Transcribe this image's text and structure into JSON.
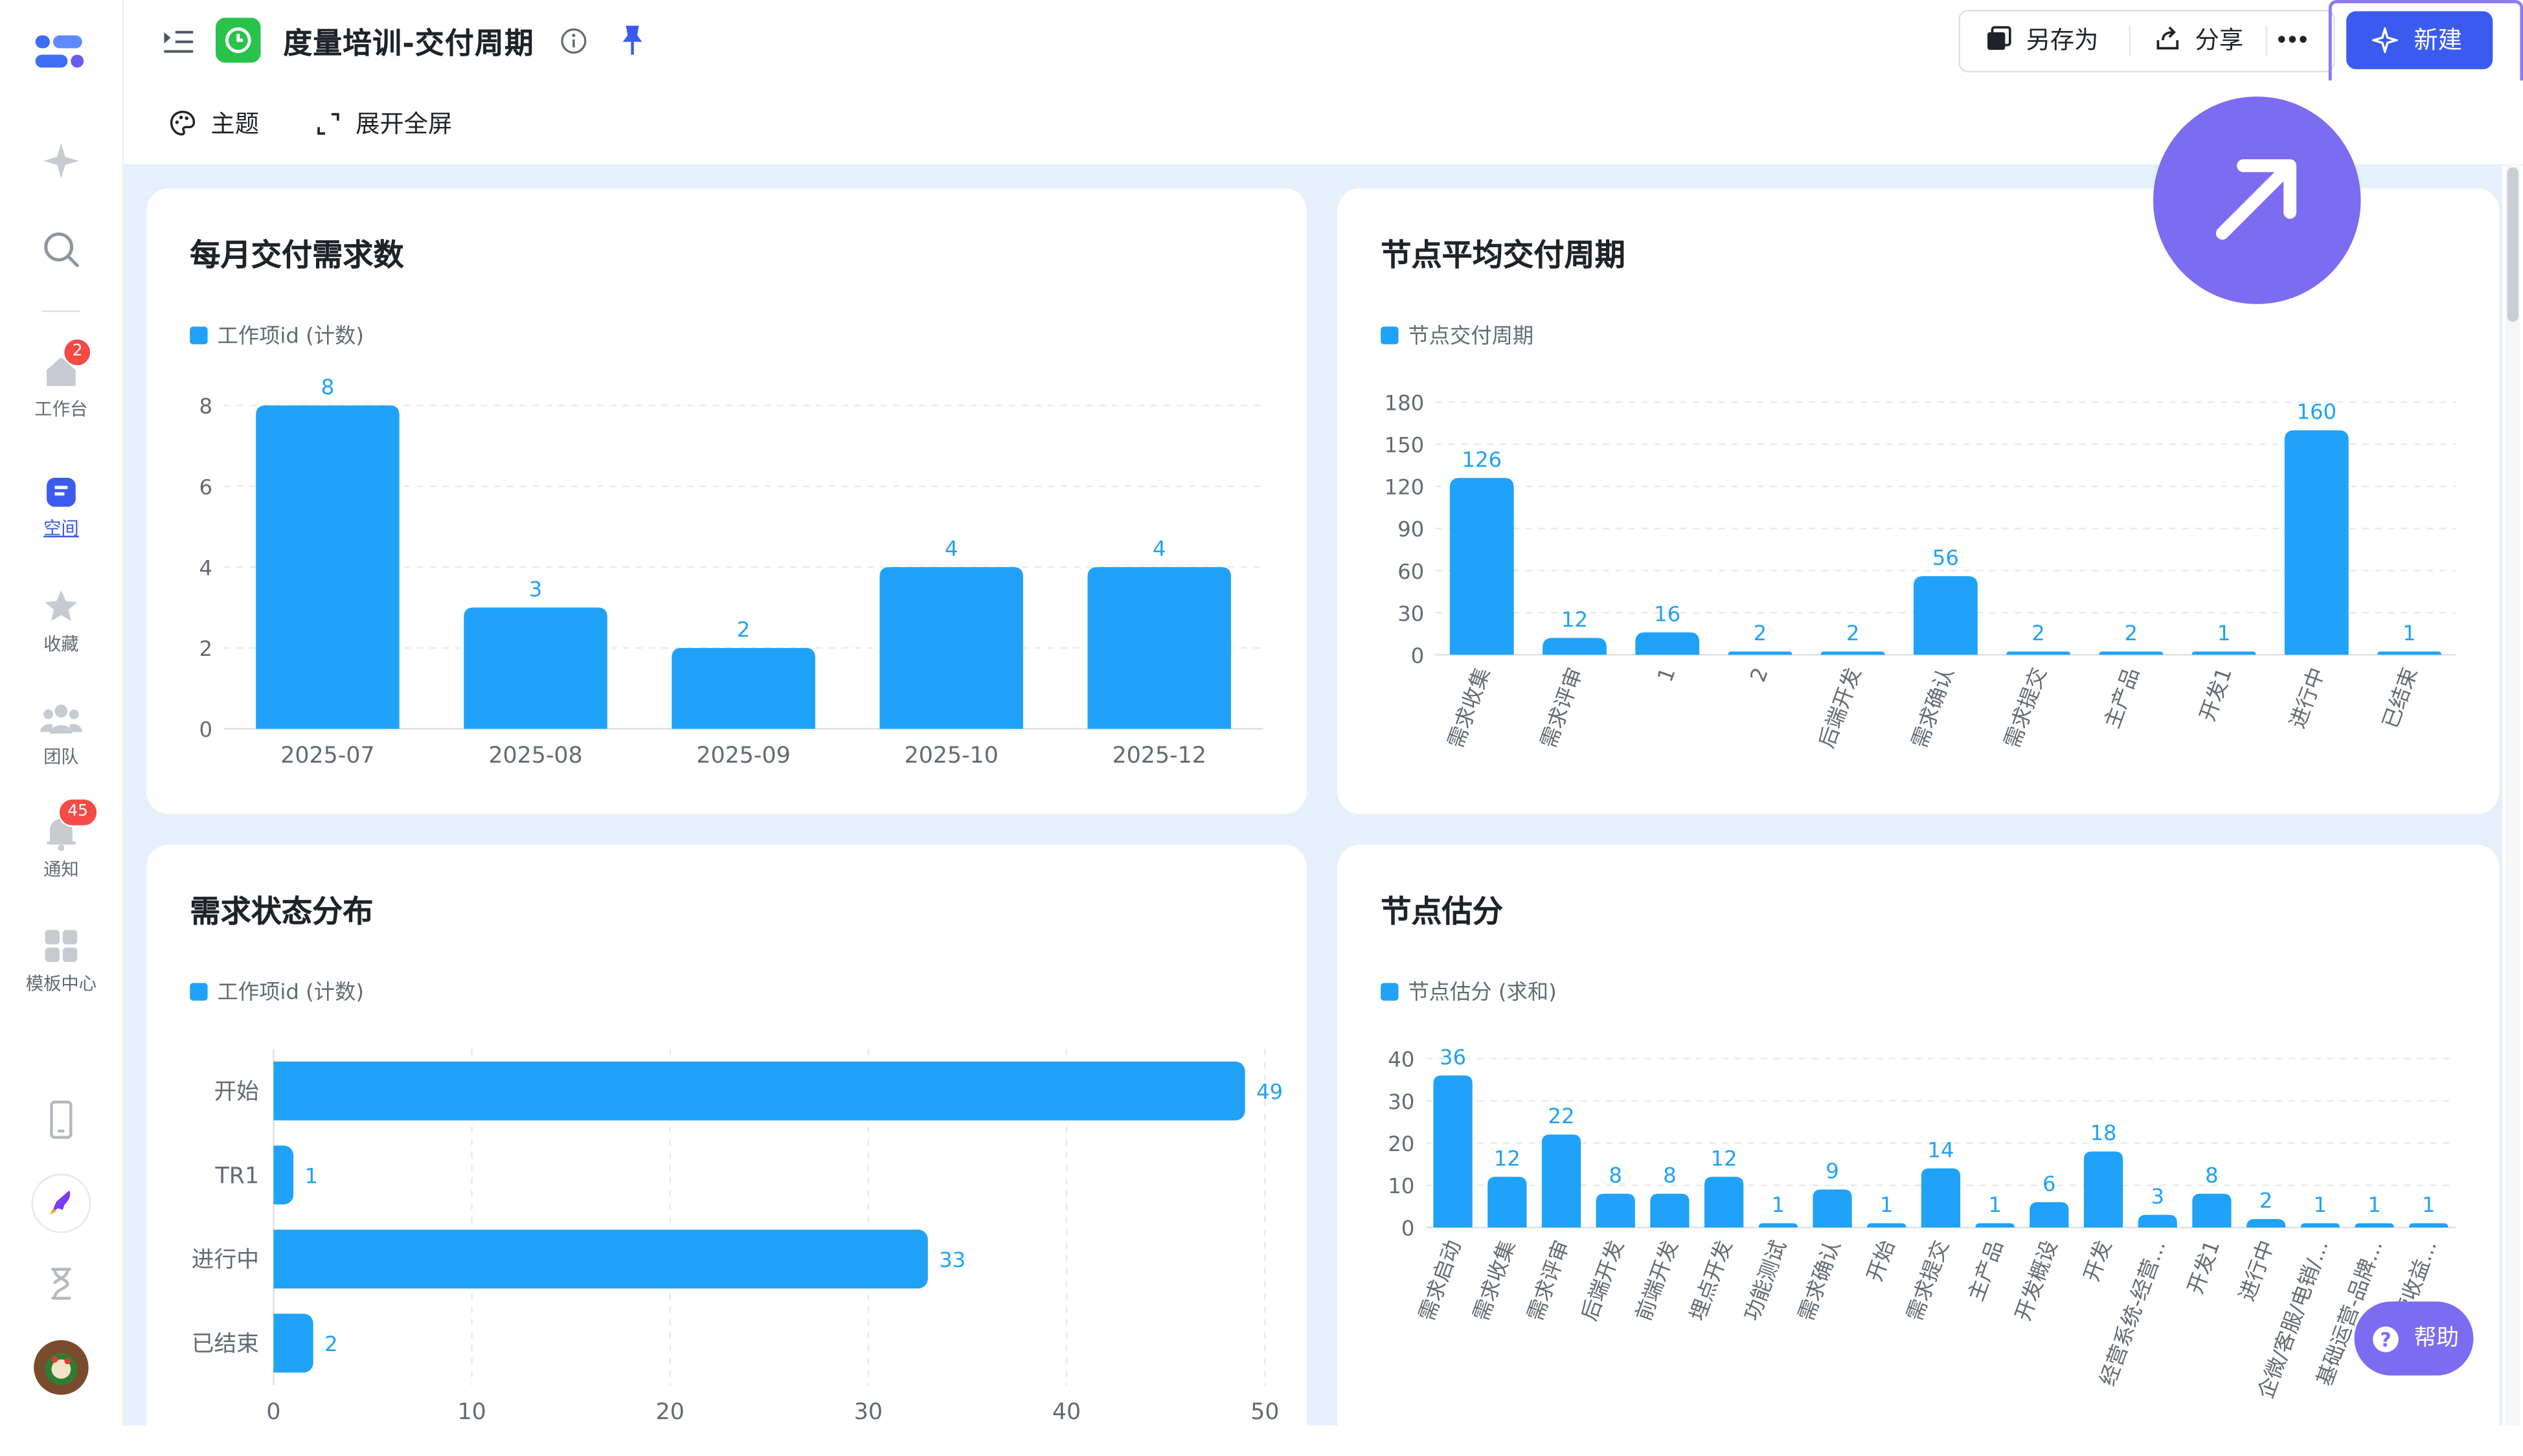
{
  "header": {
    "title": "度量培训-交付周期",
    "save_as": "另存为",
    "share": "分享",
    "more": "•••",
    "new": "新建"
  },
  "toolbar": {
    "theme": "主题",
    "fullscreen": "展开全屏"
  },
  "sidebar": {
    "items": [
      {
        "label": "工作台",
        "badge": "2"
      },
      {
        "label": "空间"
      },
      {
        "label": "收藏"
      },
      {
        "label": "团队"
      },
      {
        "label": "通知",
        "badge": "45"
      },
      {
        "label": "模板中心"
      }
    ]
  },
  "help": {
    "label": "帮助"
  },
  "colors": {
    "bar": "#1fa2f8",
    "accent": "#3b5bf0",
    "fab": "#7b6cf2"
  },
  "chart_data": [
    {
      "type": "bar",
      "title": "每月交付需求数",
      "legend": "工作项id (计数)",
      "categories": [
        "2025-07",
        "2025-08",
        "2025-09",
        "2025-10",
        "2025-12"
      ],
      "values": [
        8,
        3,
        2,
        4,
        4
      ],
      "yticks": [
        "0",
        "2",
        "4",
        "6",
        "8"
      ],
      "ylim": [
        0,
        8
      ],
      "grid": true
    },
    {
      "type": "bar",
      "title": "节点平均交付周期",
      "legend": "节点交付周期",
      "categories": [
        "需求收集",
        "需求评审",
        "1",
        "2",
        "后端开发",
        "需求确认",
        "需求提交",
        "主产品",
        "开发1",
        "进行中",
        "已结束"
      ],
      "values": [
        126,
        12,
        16,
        2,
        2,
        56,
        2,
        2,
        1,
        160,
        1
      ],
      "yticks": [
        "0",
        "30",
        "60",
        "90",
        "120",
        "150",
        "180"
      ],
      "ylim": [
        0,
        180
      ],
      "grid": true
    },
    {
      "type": "bar",
      "orientation": "horizontal",
      "title": "需求状态分布",
      "legend": "工作项id (计数)",
      "categories": [
        "开始",
        "TR1",
        "进行中",
        "已结束"
      ],
      "values": [
        49,
        1,
        33,
        2
      ],
      "xticks": [
        "0",
        "10",
        "20",
        "30",
        "40",
        "50"
      ],
      "xlim": [
        0,
        50
      ],
      "grid": true
    },
    {
      "type": "bar",
      "title": "节点估分",
      "legend": "节点估分 (求和)",
      "categories": [
        "需求启动",
        "需求收集",
        "需求评审",
        "后端开发",
        "前端开发",
        "埋点开发",
        "功能测试",
        "需求确认",
        "开始",
        "需求提交",
        "主产品",
        "开发概设",
        "开发",
        "经营系统-经营...",
        "开发1",
        "进行中",
        "企微/客服/电销/...",
        "基础运营-品牌...",
        "经营收益..."
      ],
      "values": [
        36,
        12,
        22,
        8,
        8,
        12,
        1,
        9,
        1,
        14,
        1,
        6,
        18,
        3,
        8,
        2,
        1,
        1,
        1
      ],
      "yticks": [
        "0",
        "10",
        "20",
        "30",
        "40"
      ],
      "ylim": [
        0,
        40
      ],
      "grid": true
    }
  ]
}
